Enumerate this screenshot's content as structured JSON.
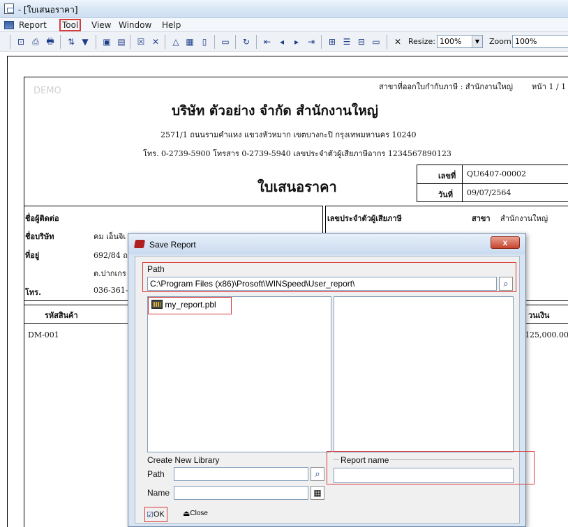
{
  "window": {
    "title": "- [ใบเสนอราคา]"
  },
  "menu": [
    "Report",
    "Tool",
    "View",
    "Window",
    "Help"
  ],
  "toolbar": {
    "resize_label": "Resize:",
    "resize_value": "100%",
    "zoom_label": "Zoom:",
    "zoom_value": "100%"
  },
  "report": {
    "watermark": "DEMO",
    "branch_header": "สาขาที่ออกใบกำกับภาษี : สำนักงานใหญ่",
    "page": "หน้า 1 / 1",
    "company": "บริษัท ตัวอย่าง จำกัด   สำนักงานใหญ่",
    "address": "2571/1 ถนนรามคำแหง แขวงหัวหมาก เขตบางกะปิ กรุงเทพมหานคร 10240",
    "phone_line": "โทร. 0-2739-5900  โทรสาร 0-2739-5940  เลขประจำตัวผู้เสียภาษีอากร 1234567890123",
    "doc_title": "ใบเสนอราคา",
    "doc_no_label": "เลขที่",
    "doc_no": "QU6407-00002",
    "date_label": "วันที่",
    "date": "09/07/2564",
    "contact_label": "ชื่อผู้ติดต่อ",
    "company_label": "ชื่อบริษัท",
    "company_value": "คม เอ็นจิเ",
    "address_label": "ที่อยู่",
    "address_value1": "692/84 ถ.",
    "address_value2": "ต.ปากเกร",
    "tel_label": "โทร.",
    "tel_value": "036-361-",
    "taxid_label": "เลขประจำตัวผู้เสียภาษี",
    "branch_label": "สาขา",
    "branch_value": "สำนักงานใหญ่",
    "col_code": "รหัสสินค้า",
    "col_amount": "วนเงิน",
    "row_code": "DM-001",
    "row_amount": "125,000.00"
  },
  "dialog": {
    "title": "Save Report",
    "close": "x",
    "path_label": "Path",
    "path_value": "C:\\Program Files (x86)\\Prosoft\\WINSpeed\\User_report\\",
    "library_item": "my_report.pbl",
    "create_group": "Create New Library",
    "create_path_label": "Path",
    "create_name_label": "Name",
    "report_name_label": "Report name",
    "ok": "OK",
    "close_btn": "Close"
  }
}
